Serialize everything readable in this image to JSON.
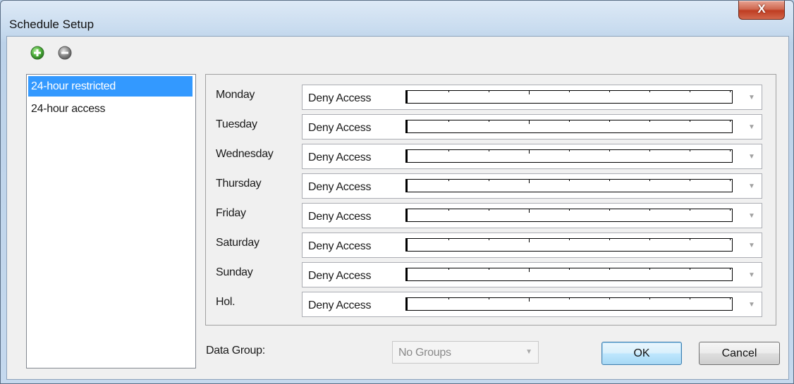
{
  "window": {
    "title": "Schedule Setup",
    "close_label": "X"
  },
  "toolbar": {
    "add_icon": "plus-circle-green",
    "remove_icon": "minus-circle-gray"
  },
  "schedules": [
    {
      "label": "24-hour restricted",
      "selected": true
    },
    {
      "label": "24-hour access",
      "selected": false
    }
  ],
  "days": [
    {
      "label": "Monday",
      "value": "Deny Access"
    },
    {
      "label": "Tuesday",
      "value": "Deny Access"
    },
    {
      "label": "Wednesday",
      "value": "Deny Access"
    },
    {
      "label": "Thursday",
      "value": "Deny Access"
    },
    {
      "label": "Friday",
      "value": "Deny Access"
    },
    {
      "label": "Saturday",
      "value": "Deny Access"
    },
    {
      "label": "Sunday",
      "value": "Deny Access"
    },
    {
      "label": "Hol.",
      "value": "Deny Access"
    }
  ],
  "data_group": {
    "label": "Data Group:",
    "value": "No Groups"
  },
  "buttons": {
    "ok": "OK",
    "cancel": "Cancel"
  },
  "colors": {
    "selection": "#3399ff",
    "add_icon": "#4caf3a",
    "remove_icon": "#8a8a8a"
  }
}
